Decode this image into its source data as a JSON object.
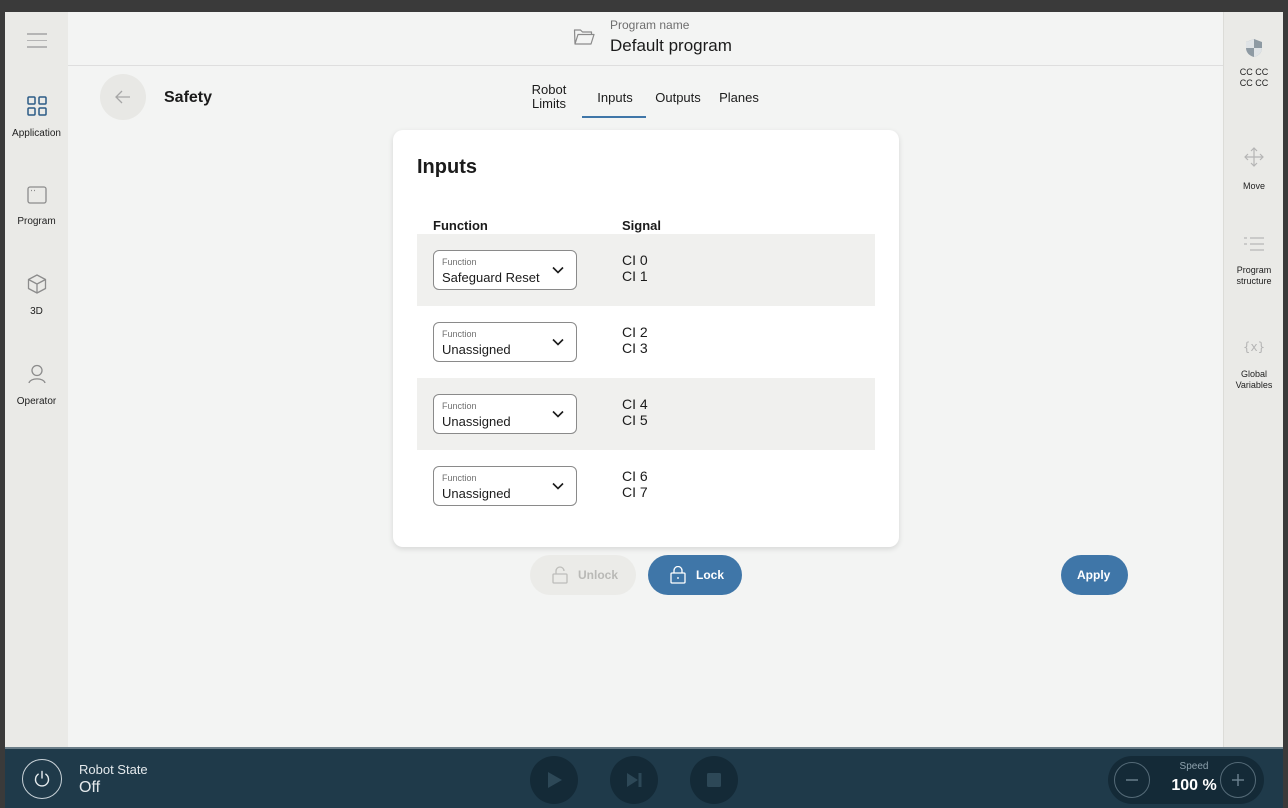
{
  "header": {
    "program_caption": "Program name",
    "program_name": "Default program"
  },
  "left_nav": {
    "items": [
      {
        "label": "Application",
        "icon": "grid-icon"
      },
      {
        "label": "Program",
        "icon": "program-window-icon"
      },
      {
        "label": "3D",
        "icon": "cube-icon"
      },
      {
        "label": "Operator",
        "icon": "user-icon"
      }
    ]
  },
  "right_rail": {
    "items": [
      {
        "label": "CC CC\nCC CC",
        "icon": "shield-icon"
      },
      {
        "label": "Move",
        "icon": "move-arrows-icon"
      },
      {
        "label": "Program\nstructure",
        "icon": "list-icon"
      },
      {
        "label": "Global\nVariables",
        "icon": "variable-icon"
      }
    ]
  },
  "page": {
    "title": "Safety"
  },
  "tabs": [
    {
      "label": "Robot\nLimits",
      "active": false
    },
    {
      "label": "Inputs",
      "active": true
    },
    {
      "label": "Outputs",
      "active": false
    },
    {
      "label": "Planes",
      "active": false
    }
  ],
  "card": {
    "title": "Inputs",
    "col_function": "Function",
    "col_signal": "Signal",
    "rows": [
      {
        "select_caption": "Function",
        "function": "Safeguard Reset",
        "signals": "CI 0\nCI 1"
      },
      {
        "select_caption": "Function",
        "function": "Unassigned",
        "signals": "CI 2\nCI 3"
      },
      {
        "select_caption": "Function",
        "function": "Unassigned",
        "signals": "CI 4\nCI 5"
      },
      {
        "select_caption": "Function",
        "function": "Unassigned",
        "signals": "CI 6\nCI 7"
      }
    ]
  },
  "buttons": {
    "unlock": "Unlock",
    "lock": "Lock",
    "apply": "Apply"
  },
  "bottom_bar": {
    "robot_state_caption": "Robot State",
    "robot_state": "Off",
    "speed_caption": "Speed",
    "speed_value": "100 %"
  },
  "colors": {
    "accent": "#3f76a8",
    "bottom_bar": "#1f3a4a"
  }
}
